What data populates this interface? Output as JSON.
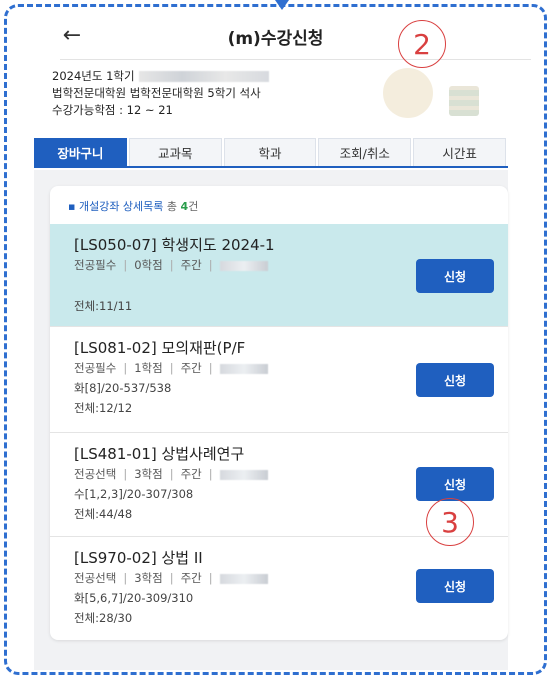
{
  "header": {
    "title": "(m)수강신청",
    "back_icon": "←"
  },
  "annotations": {
    "circle_2": "2",
    "circle_3": "3"
  },
  "info": {
    "line1": "2024년도 1학기",
    "line2": "법학전문대학원 법학전문대학원 5학기 석사",
    "line3": "수강가능학점 : 12 ~ 21"
  },
  "tabs": [
    {
      "label": "장바구니",
      "active": true
    },
    {
      "label": "교과목",
      "active": false
    },
    {
      "label": "학과",
      "active": false
    },
    {
      "label": "조회/취소",
      "active": false
    },
    {
      "label": "시간표",
      "active": false
    }
  ],
  "list": {
    "heading": "개설강좌 상세목록",
    "total_label": "총",
    "count": "4",
    "count_suffix": "건"
  },
  "courses": [
    {
      "title": "[LS050-07] 학생지도 2024-1",
      "type": "전공필수",
      "credits": "0학점",
      "time": "주간",
      "schedule": "",
      "capacity": "전체:11/11",
      "button": "신청"
    },
    {
      "title": "[LS081-02] 모의재판(P/F",
      "type": "전공필수",
      "credits": "1학점",
      "time": "주간",
      "schedule": "화[8]/20-537/538",
      "capacity": "전체:12/12",
      "button": "신청"
    },
    {
      "title": "[LS481-01] 상법사례연구",
      "type": "전공선택",
      "credits": "3학점",
      "time": "주간",
      "schedule": "수[1,2,3]/20-307/308",
      "capacity": "전체:44/48",
      "button": "신청"
    },
    {
      "title": "[LS970-02] 상법 II",
      "type": "전공선택",
      "credits": "3학점",
      "time": "주간",
      "schedule": "화[5,6,7]/20-309/310",
      "capacity": "전체:28/30",
      "button": "신청"
    }
  ],
  "colors": {
    "accent": "#1f5fbf",
    "highlight": "#c9e9ec",
    "annotation": "#d94040",
    "frame": "#2f6fd0"
  }
}
